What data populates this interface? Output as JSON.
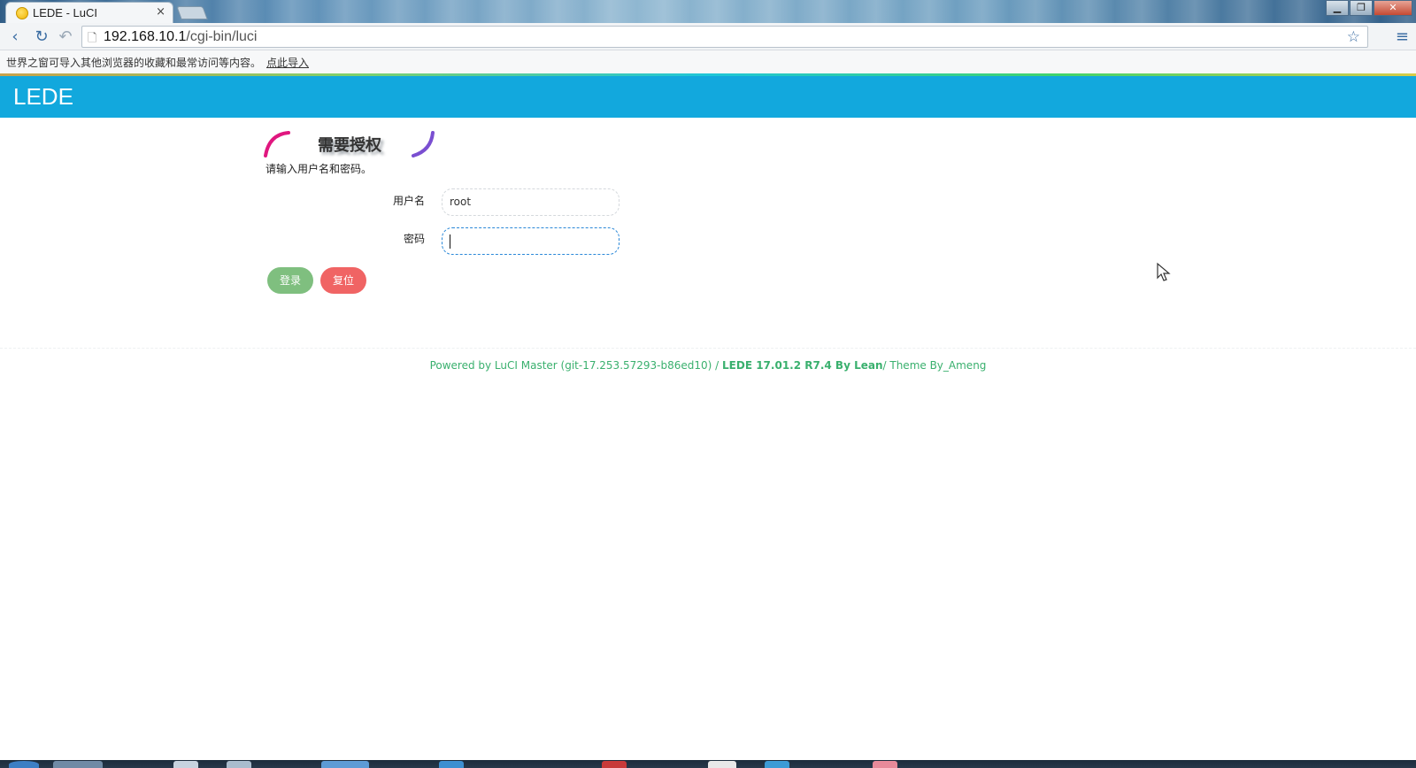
{
  "browser": {
    "tab_title": "LEDE - LuCI",
    "tab_close": "×",
    "url_host": "192.168.10.1",
    "url_path": "/cgi-bin/luci",
    "window_controls": {
      "minimize": "▁",
      "maximize": "❐",
      "close": "✕"
    },
    "icons": {
      "back": "‹",
      "reload": "↻",
      "undo": "↶",
      "page": "🗋",
      "star": "☆",
      "menu": "≡"
    }
  },
  "infobar": {
    "message": "世界之窗可导入其他浏览器的收藏和最常访问等内容。",
    "link": "点此导入"
  },
  "header": {
    "brand": "LEDE",
    "color": "#12a8dd"
  },
  "login": {
    "title": "需要授权",
    "description": "请输入用户名和密码。",
    "username_label": "用户名",
    "username_value": "root",
    "password_label": "密码",
    "password_value": "",
    "login_button": "登录",
    "reset_button": "复位",
    "login_color": "#7fbf7f",
    "reset_color": "#f06464"
  },
  "footer": {
    "prefix": "Powered by LuCI Master (git-17.253.57293-b86ed10) / ",
    "version": "LEDE 17.01.2 R7.4 By Lean",
    "suffix": "/ Theme By_Ameng"
  }
}
